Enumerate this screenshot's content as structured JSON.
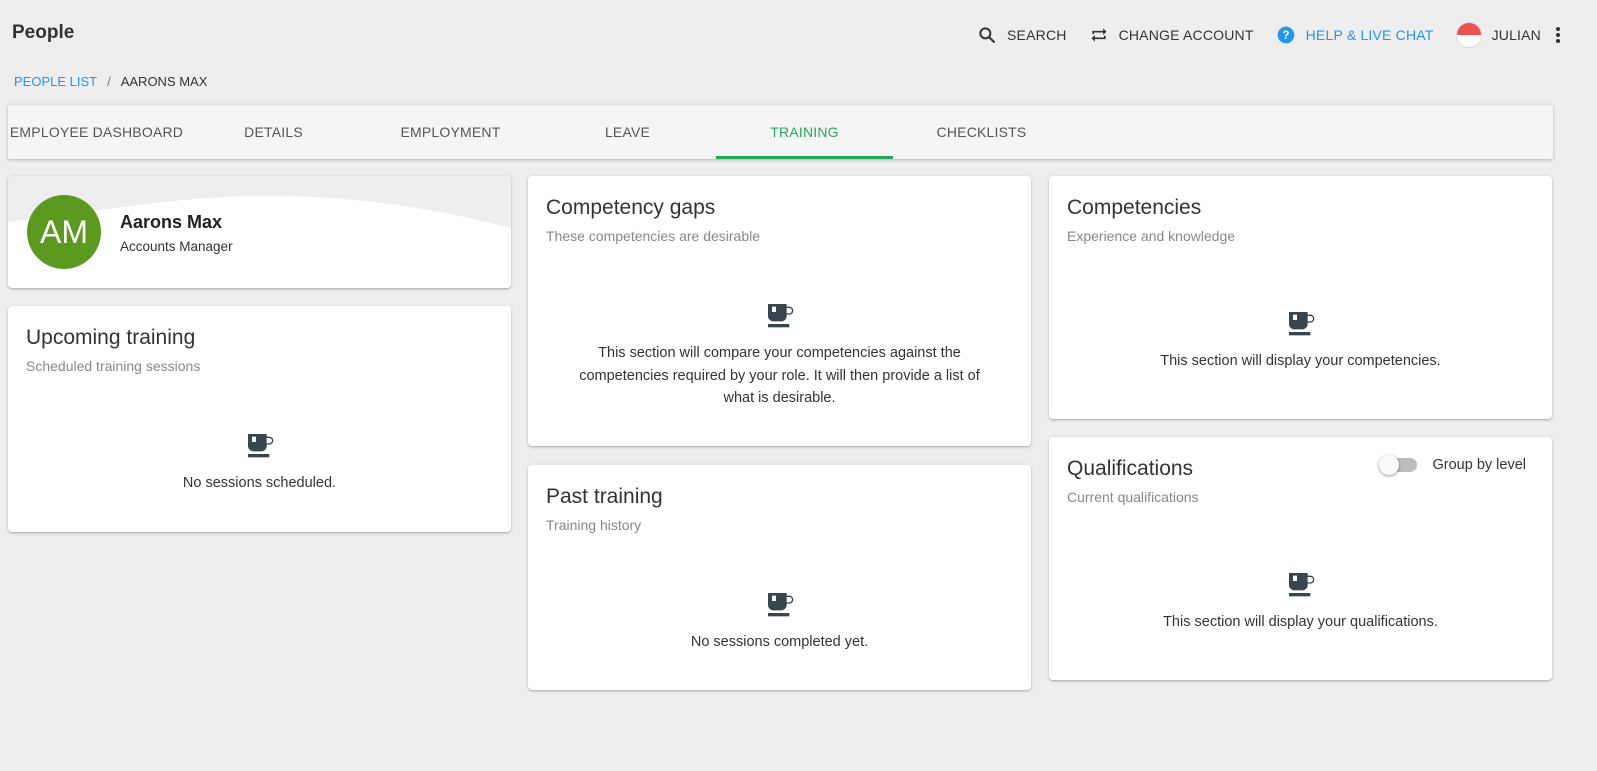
{
  "app": {
    "title": "People"
  },
  "topbar": {
    "search_label": "SEARCH",
    "change_account_label": "CHANGE ACCOUNT",
    "help_label": "HELP & LIVE CHAT",
    "user_label": "JULIAN"
  },
  "breadcrumb": {
    "parent": "PEOPLE LIST",
    "separator": "/",
    "current": "AARONS MAX"
  },
  "tabs": [
    {
      "label": "EMPLOYEE DASHBOARD"
    },
    {
      "label": "DETAILS"
    },
    {
      "label": "EMPLOYMENT"
    },
    {
      "label": "LEAVE"
    },
    {
      "label": "TRAINING",
      "active": true
    },
    {
      "label": "CHECKLISTS"
    }
  ],
  "profile": {
    "initials": "AM",
    "name": "Aarons Max",
    "role": "Accounts Manager",
    "avatar_color": "#5b9a1f"
  },
  "upcoming": {
    "title": "Upcoming training",
    "subtitle": "Scheduled training sessions",
    "empty_text": "No sessions scheduled."
  },
  "gaps": {
    "title": "Competency gaps",
    "subtitle": "These competencies are desirable",
    "empty_line1": "This section will compare your competencies against the",
    "empty_line2": "competencies required by your role. It will then provide a list of",
    "empty_line3": "what is desirable."
  },
  "past": {
    "title": "Past training",
    "subtitle": "Training history",
    "empty_text": "No sessions completed yet."
  },
  "competencies": {
    "title": "Competencies",
    "subtitle": "Experience and knowledge",
    "empty_text": "This section will display your competencies."
  },
  "qualifications": {
    "title": "Qualifications",
    "subtitle": "Current qualifications",
    "toggle_label": "Group by level",
    "toggle_on": false,
    "empty_text": "This section will display your qualifications."
  },
  "colors": {
    "accent_green": "#26a65b",
    "link_blue": "#2196f3",
    "icon_dark": "#37474f"
  }
}
